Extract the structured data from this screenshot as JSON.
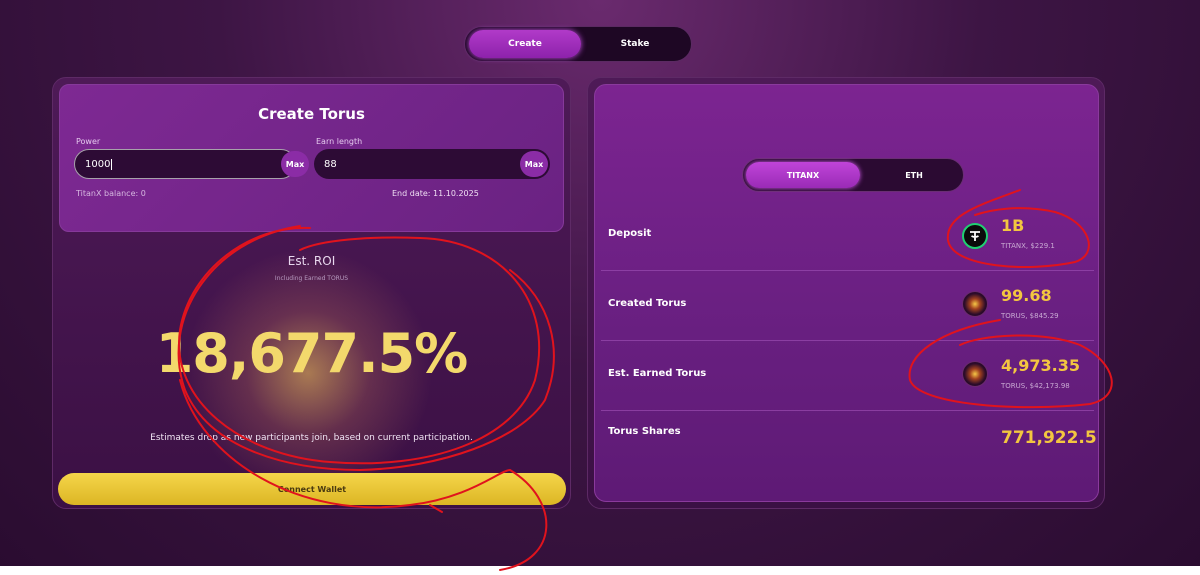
{
  "mode_toggle": {
    "create": "Create",
    "stake": "Stake",
    "active": "Create"
  },
  "create_card": {
    "title": "Create Torus",
    "power_label": "Power",
    "power_value": "1000",
    "max_label": "Max",
    "earn_label": "Earn length",
    "earn_value": "88",
    "balance_note": "TitanX balance: 0",
    "end_date_note": "End date: 11.10.2025"
  },
  "roi": {
    "title": "Est. ROI",
    "subtitle": "Including Earned TORUS",
    "value": "18,677.5%",
    "note": "Estimates drop as new participants join, based on current participation."
  },
  "connect_wallet": "Connect Wallet",
  "token_toggle": {
    "titanx": "TITANX",
    "eth": "ETH",
    "active": "TITANX"
  },
  "summary": {
    "deposit": {
      "label": "Deposit",
      "value": "1B",
      "sub": "TITANX, $229.1",
      "icon": "tether-icon"
    },
    "created": {
      "label": "Created Torus",
      "value": "99.68",
      "sub": "TORUS, $845.29",
      "icon": "torus-icon"
    },
    "earned": {
      "label": "Est. Earned Torus",
      "value": "4,973.35",
      "sub": "TORUS, $42,173.98",
      "icon": "torus-icon"
    },
    "shares": {
      "label": "Torus Shares",
      "value": "771,922.5"
    }
  },
  "colors": {
    "accent_yellow": "#f3c640",
    "annotation_red": "#e0131d",
    "active_toggle": "#a430c2"
  }
}
